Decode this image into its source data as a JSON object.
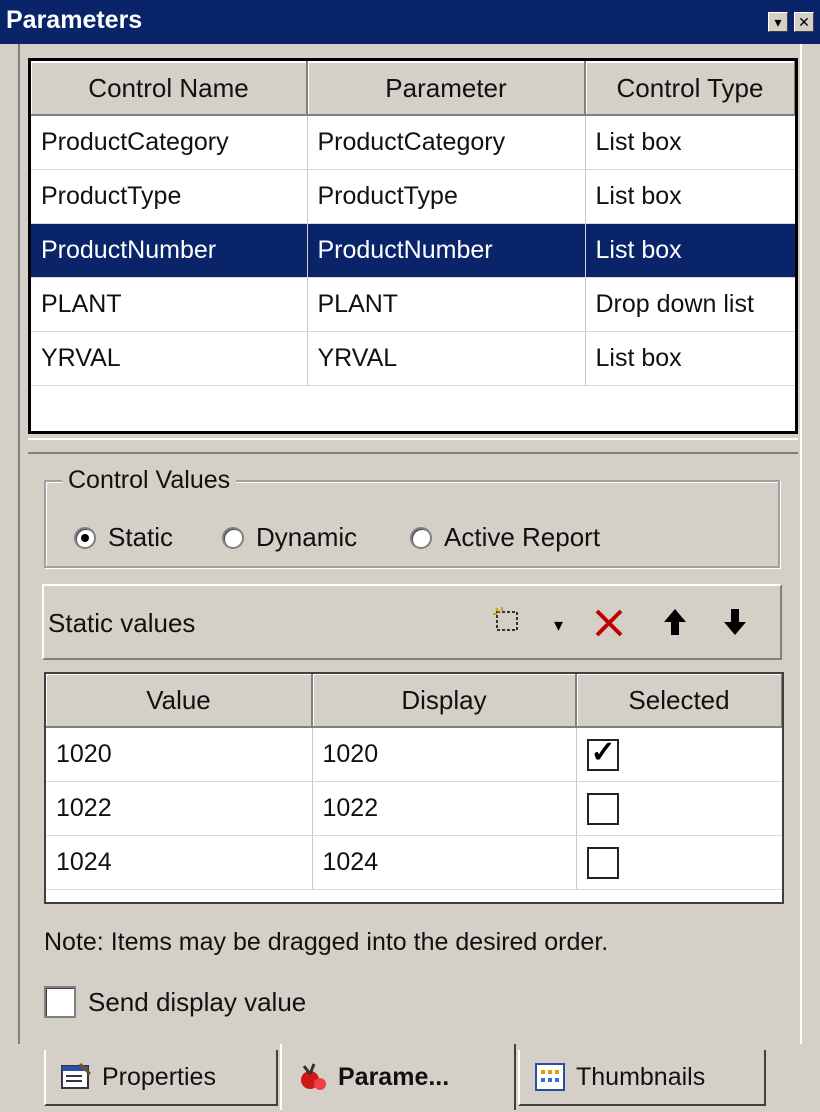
{
  "window": {
    "title": "Parameters",
    "menu_glyph": "▾",
    "close_glyph": "✕"
  },
  "parameters_grid": {
    "headers": [
      "Control Name",
      "Parameter",
      "Control Type"
    ],
    "rows": [
      [
        "ProductCategory",
        "ProductCategory",
        "List box"
      ],
      [
        "ProductType",
        "ProductType",
        "List box"
      ],
      [
        "ProductNumber",
        "ProductNumber",
        "List box"
      ],
      [
        "PLANT",
        "PLANT",
        "Drop down list"
      ],
      [
        "YRVAL",
        "YRVAL",
        "List box"
      ]
    ],
    "selected_row": 2,
    "selection_color": "#0a246a"
  },
  "control_values": {
    "legend": "Control Values",
    "options": [
      "Static",
      "Dynamic",
      "Active Report"
    ],
    "selected": "Static"
  },
  "static_values": {
    "label": "Static values",
    "icons": [
      "new-value-icon",
      "dropdown-arrow-icon",
      "delete-icon",
      "move-up-icon",
      "move-down-icon"
    ],
    "delete_color": "#c00000",
    "headers": [
      "Value",
      "Display",
      "Selected"
    ],
    "rows": [
      {
        "value": "1020",
        "display": "1020",
        "selected": true
      },
      {
        "value": "1022",
        "display": "1022",
        "selected": false
      },
      {
        "value": "1024",
        "display": "1024",
        "selected": false
      }
    ]
  },
  "note": "Note:  Items may be dragged into the desired order.",
  "send_display_value": {
    "label": "Send display value",
    "checked": false
  },
  "tabs": [
    {
      "label": "Properties",
      "icon": "properties-icon",
      "active": false
    },
    {
      "label": "Parame...",
      "icon": "parameters-icon",
      "active": true
    },
    {
      "label": "Thumbnails",
      "icon": "thumbnails-icon",
      "active": false
    }
  ]
}
